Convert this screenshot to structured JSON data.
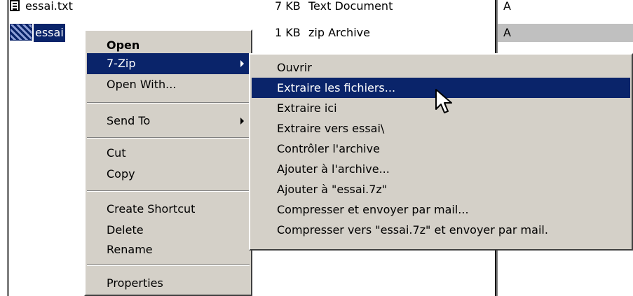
{
  "files": [
    {
      "name": "essai.txt",
      "size": "7 KB",
      "type": "Text Document",
      "attr": "A"
    },
    {
      "name": "essai",
      "size": "1 KB",
      "type": "zip Archive",
      "attr": "A"
    }
  ],
  "context_menu": {
    "items": [
      {
        "label": "Open"
      },
      {
        "label": "7-Zip"
      },
      {
        "label": "Open With..."
      },
      {
        "label": "Send To"
      },
      {
        "label": "Cut"
      },
      {
        "label": "Copy"
      },
      {
        "label": "Create Shortcut"
      },
      {
        "label": "Delete"
      },
      {
        "label": "Rename"
      },
      {
        "label": "Properties"
      }
    ]
  },
  "submenu_7zip": {
    "items": [
      {
        "label": "Ouvrir"
      },
      {
        "label": "Extraire les fichiers..."
      },
      {
        "label": "Extraire ici"
      },
      {
        "label": "Extraire vers essai\\"
      },
      {
        "label": "Contrôler l'archive"
      },
      {
        "label": "Ajouter à l'archive..."
      },
      {
        "label": "Ajouter à \"essai.7z\""
      },
      {
        "label": "Compresser et envoyer par mail..."
      },
      {
        "label": "Compresser vers \"essai.7z\" et envoyer par mail."
      }
    ]
  },
  "colors": {
    "highlight": "#0a246a",
    "menu_bg": "#d4d0c8"
  },
  "icons": [
    "text-file-icon",
    "zip-archive-icon",
    "submenu-arrow-icon",
    "mouse-cursor-icon"
  ]
}
